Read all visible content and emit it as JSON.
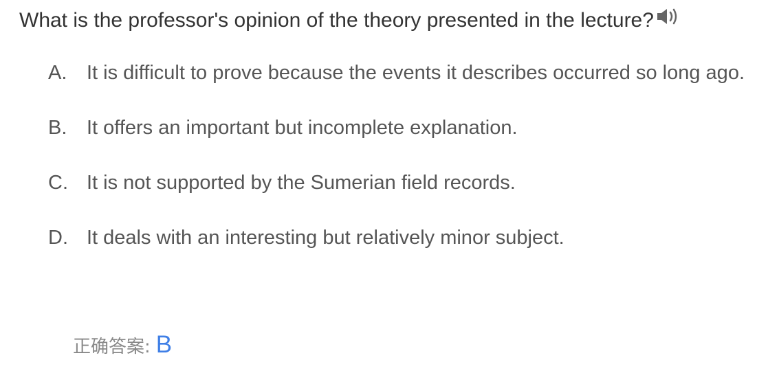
{
  "question": {
    "text": "What is the professor's opinion of the theory presented in the lecture?",
    "audio_icon": "speaker-icon"
  },
  "options": [
    {
      "letter": "A.",
      "text": "It is difficult to prove because the events it describes occurred so long ago."
    },
    {
      "letter": "B.",
      "text": "It offers an important but incomplete explanation."
    },
    {
      "letter": "C.",
      "text": "It is not supported by the Sumerian field records."
    },
    {
      "letter": "D.",
      "text": "It deals with an interesting but relatively minor subject."
    }
  ],
  "answer": {
    "label": "正确答案:",
    "value": "B"
  },
  "colors": {
    "question_text": "#333333",
    "option_text": "#555555",
    "answer_label": "#888888",
    "answer_value": "#3f7fe6",
    "icon": "#666666"
  }
}
